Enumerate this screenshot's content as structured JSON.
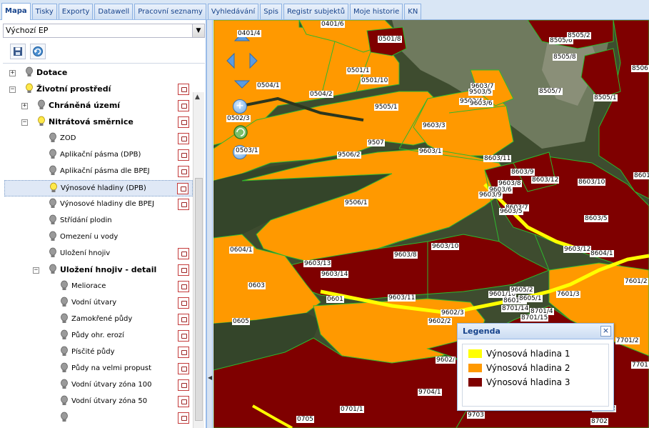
{
  "tabs": [
    {
      "label": "Mapa",
      "active": true
    },
    {
      "label": "Tisky"
    },
    {
      "label": "Exporty"
    },
    {
      "label": "Datawell"
    },
    {
      "label": "Pracovní seznamy"
    },
    {
      "label": "Vyhledávání"
    },
    {
      "label": "Spis"
    },
    {
      "label": "Registr subjektů"
    },
    {
      "label": "Moje historie"
    },
    {
      "label": "KN"
    }
  ],
  "selector": {
    "value": "Výchozí EP"
  },
  "toolbar": {
    "save_icon": "save-icon",
    "refresh_icon": "refresh-icon"
  },
  "tree": [
    {
      "label": "Dotace",
      "bold": true,
      "level": 0,
      "expander": "+",
      "bulb": "off",
      "icon": false
    },
    {
      "label": "Životní prostředí",
      "bold": true,
      "level": 0,
      "expander": "−",
      "bulb": "on",
      "icon": true
    },
    {
      "label": "Chráněná území",
      "bold": true,
      "level": 1,
      "expander": "+",
      "bulb": "off",
      "icon": true
    },
    {
      "label": "Nitrátová směrnice",
      "bold": true,
      "level": 1,
      "expander": "−",
      "bulb": "on",
      "icon": true
    },
    {
      "label": "ZOD",
      "level": 2,
      "bulb": "off",
      "icon": true
    },
    {
      "label": "Aplikační pásma (DPB)",
      "level": 2,
      "bulb": "off",
      "icon": true
    },
    {
      "label": "Aplikační pásma dle BPEJ",
      "level": 2,
      "bulb": "off",
      "icon": true
    },
    {
      "label": "Výnosové hladiny (DPB)",
      "level": 2,
      "bulb": "on",
      "icon": true,
      "selected": true
    },
    {
      "label": "Výnosové hladiny dle BPEJ",
      "level": 2,
      "bulb": "off",
      "icon": true
    },
    {
      "label": "Střídání plodin",
      "level": 2,
      "bulb": "off",
      "icon": false
    },
    {
      "label": "Omezení u vody",
      "level": 2,
      "bulb": "off",
      "icon": false
    },
    {
      "label": "Uložení hnojiv",
      "level": 2,
      "bulb": "off",
      "icon": true
    },
    {
      "label": "Uložení hnojiv - detail",
      "bold": true,
      "level": 2,
      "expander": "−",
      "bulb": "off",
      "icon": true
    },
    {
      "label": "Meliorace",
      "level": 3,
      "bulb": "off",
      "icon": true
    },
    {
      "label": "Vodní útvary",
      "level": 3,
      "bulb": "off",
      "icon": true
    },
    {
      "label": "Zamokřené půdy",
      "level": 3,
      "bulb": "off",
      "icon": true
    },
    {
      "label": "Půdy ohr. erozí",
      "level": 3,
      "bulb": "off",
      "icon": true
    },
    {
      "label": "Písčité půdy",
      "level": 3,
      "bulb": "off",
      "icon": true
    },
    {
      "label": "Půdy na velmi propust",
      "level": 3,
      "bulb": "off",
      "icon": true
    },
    {
      "label": "Vodní útvary zóna 100",
      "level": 3,
      "bulb": "off",
      "icon": true
    },
    {
      "label": "Vodní útvary zóna 50",
      "level": 3,
      "bulb": "off",
      "icon": true
    },
    {
      "label": "",
      "level": 3,
      "bulb": "off",
      "icon": true
    }
  ],
  "colors": {
    "level1": "#ffff00",
    "level2": "#ff9900",
    "level3": "#7f0000",
    "boundary": "#2eb82e",
    "forest": "#34452a"
  },
  "map": {
    "labels": [
      {
        "t": "0401/4"
      },
      {
        "t": "0401/6"
      },
      {
        "t": "0501/8"
      },
      {
        "t": "8505/6"
      },
      {
        "t": "8505/2"
      },
      {
        "t": "8505/8"
      },
      {
        "t": "8506"
      },
      {
        "t": "0501/1"
      },
      {
        "t": "0501/10"
      },
      {
        "t": "0504/1"
      },
      {
        "t": "0504/2"
      },
      {
        "t": "9603/7"
      },
      {
        "t": "9503/5"
      },
      {
        "t": "9503/4"
      },
      {
        "t": "8505/7"
      },
      {
        "t": "8505/1"
      },
      {
        "t": "9505/1"
      },
      {
        "t": "9603/6"
      },
      {
        "t": "0502/3"
      },
      {
        "t": "9603/3"
      },
      {
        "t": "0503/1"
      },
      {
        "t": "9507"
      },
      {
        "t": "9506/2"
      },
      {
        "t": "9603/1"
      },
      {
        "t": "8603/11"
      },
      {
        "t": "8603/9"
      },
      {
        "t": "8601"
      },
      {
        "t": "8603/12"
      },
      {
        "t": "9603/8"
      },
      {
        "t": "8603/10"
      },
      {
        "t": "9603/6"
      },
      {
        "t": "9603/9"
      },
      {
        "t": "9506/1"
      },
      {
        "t": "8603/7"
      },
      {
        "t": "9603/5"
      },
      {
        "t": "8603/5"
      },
      {
        "t": "9603/10"
      },
      {
        "t": "0604/1"
      },
      {
        "t": "9603/8"
      },
      {
        "t": "9603/12"
      },
      {
        "t": "8604/1"
      },
      {
        "t": "9603/13"
      },
      {
        "t": "9603/14"
      },
      {
        "t": "7601/2"
      },
      {
        "t": "0603"
      },
      {
        "t": "9601/10"
      },
      {
        "t": "9605/2"
      },
      {
        "t": "7601/3"
      },
      {
        "t": "0601"
      },
      {
        "t": "9603/11"
      },
      {
        "t": "8601/1"
      },
      {
        "t": "8605/1"
      },
      {
        "t": "8701/14"
      },
      {
        "t": "8701/4"
      },
      {
        "t": "9602/3"
      },
      {
        "t": "0605"
      },
      {
        "t": "9602/2"
      },
      {
        "t": "8701/15"
      },
      {
        "t": "7701/2"
      },
      {
        "t": "9602/"
      },
      {
        "t": "7701"
      },
      {
        "t": "9704/1"
      },
      {
        "t": "0701/1"
      },
      {
        "t": "8702/2"
      },
      {
        "t": "0705"
      },
      {
        "t": "9703"
      },
      {
        "t": "8702"
      }
    ]
  },
  "legend": {
    "title": "Legenda",
    "close_label": "×",
    "items": [
      {
        "label": "Výnosová hladina 1",
        "color": "#ffff00"
      },
      {
        "label": "Výnosová hladina 2",
        "color": "#ff9900"
      },
      {
        "label": "Výnosová hladina 3",
        "color": "#7f0000"
      }
    ]
  }
}
